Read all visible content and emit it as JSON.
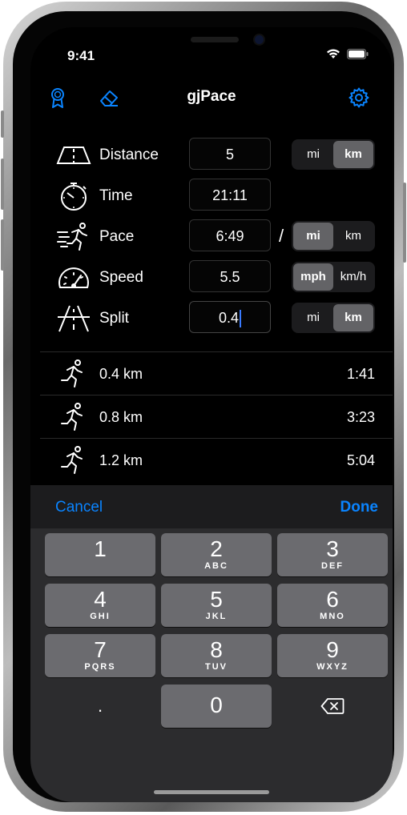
{
  "status": {
    "time": "9:41"
  },
  "nav": {
    "title": "gjPace",
    "left_icons": [
      "award-ribbon-icon",
      "eraser-icon"
    ],
    "right_icon": "gear-icon",
    "accent": "#0a84ff"
  },
  "form": {
    "rows": [
      {
        "label": "Distance",
        "icon": "road-icon",
        "value": "5",
        "units": [
          "mi",
          "km"
        ],
        "selected_unit": "km"
      },
      {
        "label": "Time",
        "icon": "stopwatch-icon",
        "value": "21:11"
      },
      {
        "label": "Pace",
        "icon": "runner-speed-icon",
        "value": "6:49",
        "separator": "/",
        "units": [
          "mi",
          "km"
        ],
        "selected_unit": "mi"
      },
      {
        "label": "Speed",
        "icon": "speedometer-icon",
        "value": "5.5",
        "units": [
          "mph",
          "km/h"
        ],
        "selected_unit": "mph"
      },
      {
        "label": "Split",
        "icon": "highway-icon",
        "value": "0.4",
        "units": [
          "mi",
          "km"
        ],
        "selected_unit": "km"
      }
    ]
  },
  "splits": [
    {
      "distance": "0.4 km",
      "time": "1:41"
    },
    {
      "distance": "0.8 km",
      "time": "3:23"
    },
    {
      "distance": "1.2 km",
      "time": "5:04"
    }
  ],
  "keyboard_toolbar": {
    "cancel": "Cancel",
    "done": "Done"
  },
  "keypad": [
    {
      "num": "1",
      "letters": ""
    },
    {
      "num": "2",
      "letters": "ABC"
    },
    {
      "num": "3",
      "letters": "DEF"
    },
    {
      "num": "4",
      "letters": "GHI"
    },
    {
      "num": "5",
      "letters": "JKL"
    },
    {
      "num": "6",
      "letters": "MNO"
    },
    {
      "num": "7",
      "letters": "PQRS"
    },
    {
      "num": "8",
      "letters": "TUV"
    },
    {
      "num": "9",
      "letters": "WXYZ"
    },
    {
      "num": ".",
      "letters": ""
    },
    {
      "num": "0",
      "letters": ""
    },
    {
      "num": "delete-backspace-icon",
      "letters": ""
    }
  ]
}
